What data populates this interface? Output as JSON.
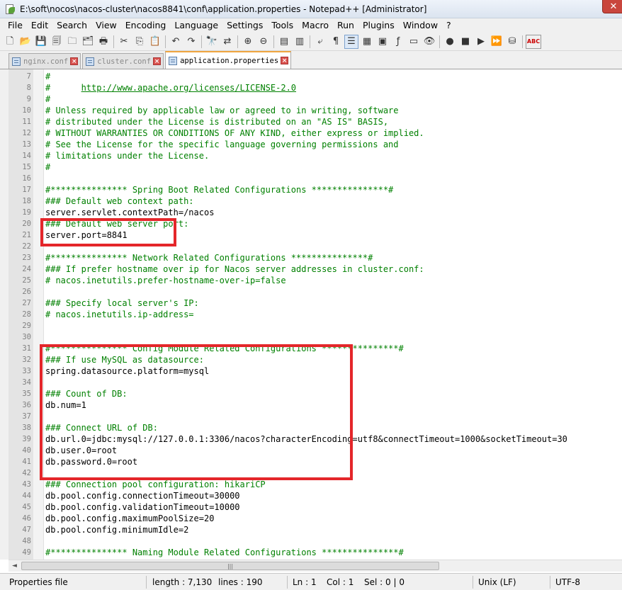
{
  "window": {
    "title": "E:\\soft\\nocos\\nacos-cluster\\nacos8841\\conf\\application.properties - Notepad++ [Administrator]",
    "close_glyph": "✕"
  },
  "menu": [
    "File",
    "Edit",
    "Search",
    "View",
    "Encoding",
    "Language",
    "Settings",
    "Tools",
    "Macro",
    "Run",
    "Plugins",
    "Window",
    "?"
  ],
  "toolbar": {
    "buttons": [
      {
        "icon": "new-file-icon",
        "glyph": "🗋"
      },
      {
        "icon": "open-file-icon",
        "glyph": "📂"
      },
      {
        "icon": "save-icon",
        "glyph": "💾"
      },
      {
        "icon": "save-all-icon",
        "glyph": "🗐"
      },
      {
        "icon": "close-icon",
        "glyph": "🗀"
      },
      {
        "icon": "close-all-icon",
        "glyph": "🗂"
      },
      {
        "icon": "print-icon",
        "glyph": "🖶"
      },
      {
        "sep": true
      },
      {
        "icon": "cut-icon",
        "glyph": "✂"
      },
      {
        "icon": "copy-icon",
        "glyph": "⎘"
      },
      {
        "icon": "paste-icon",
        "glyph": "📋"
      },
      {
        "sep": true
      },
      {
        "icon": "undo-icon",
        "glyph": "↶"
      },
      {
        "icon": "redo-icon",
        "glyph": "↷"
      },
      {
        "sep": true
      },
      {
        "icon": "find-icon",
        "glyph": "🔭"
      },
      {
        "icon": "replace-icon",
        "glyph": "⇄"
      },
      {
        "sep": true
      },
      {
        "icon": "zoom-in-icon",
        "glyph": "⊕"
      },
      {
        "icon": "zoom-out-icon",
        "glyph": "⊖"
      },
      {
        "sep": true
      },
      {
        "icon": "sync-vertical-icon",
        "glyph": "▤"
      },
      {
        "icon": "sync-horizontal-icon",
        "glyph": "▥"
      },
      {
        "sep": true
      },
      {
        "icon": "word-wrap-icon",
        "glyph": "⤶"
      },
      {
        "icon": "show-all-chars-icon",
        "glyph": "¶"
      },
      {
        "icon": "indent-guide-icon",
        "glyph": "☰",
        "active": true
      },
      {
        "icon": "user-lang-icon",
        "glyph": "▦"
      },
      {
        "icon": "doc-map-icon",
        "glyph": "▣"
      },
      {
        "icon": "function-list-icon",
        "glyph": "ƒ"
      },
      {
        "icon": "folder-workspace-icon",
        "glyph": "▭"
      },
      {
        "icon": "monitoring-icon",
        "glyph": "👁"
      },
      {
        "sep": true
      },
      {
        "icon": "record-macro-icon",
        "glyph": "●"
      },
      {
        "icon": "stop-macro-icon",
        "glyph": "■"
      },
      {
        "icon": "play-macro-icon",
        "glyph": "▶"
      },
      {
        "icon": "play-multiple-macro-icon",
        "glyph": "⏩"
      },
      {
        "icon": "save-macro-icon",
        "glyph": "⛁"
      },
      {
        "sep": true
      },
      {
        "icon": "spell-check-icon",
        "glyph": "ABC"
      }
    ]
  },
  "tabs": [
    {
      "label": "nginx.conf",
      "active": false
    },
    {
      "label": "cluster.conf",
      "active": false
    },
    {
      "label": "application.properties",
      "active": true
    }
  ],
  "editor": {
    "lines": [
      {
        "n": "7",
        "text": "#",
        "style": "comment"
      },
      {
        "n": "8",
        "text": "#      http://www.apache.org/licenses/LICENSE-2.0",
        "style": "url"
      },
      {
        "n": "9",
        "text": "#",
        "style": "comment"
      },
      {
        "n": "10",
        "text": "# Unless required by applicable law or agreed to in writing, software",
        "style": "comment"
      },
      {
        "n": "11",
        "text": "# distributed under the License is distributed on an \"AS IS\" BASIS,",
        "style": "comment"
      },
      {
        "n": "12",
        "text": "# WITHOUT WARRANTIES OR CONDITIONS OF ANY KIND, either express or implied.",
        "style": "comment"
      },
      {
        "n": "13",
        "text": "# See the License for the specific language governing permissions and",
        "style": "comment"
      },
      {
        "n": "14",
        "text": "# limitations under the License.",
        "style": "comment"
      },
      {
        "n": "15",
        "text": "#",
        "style": "comment"
      },
      {
        "n": "16",
        "text": "",
        "style": "plain"
      },
      {
        "n": "17",
        "text": "#*************** Spring Boot Related Configurations ***************#",
        "style": "comment"
      },
      {
        "n": "18",
        "text": "### Default web context path:",
        "style": "comment"
      },
      {
        "n": "19",
        "text": "server.servlet.contextPath=/nacos",
        "style": "plain"
      },
      {
        "n": "20",
        "text": "### Default web server port:",
        "style": "comment"
      },
      {
        "n": "21",
        "text": "server.port=8841",
        "style": "plain"
      },
      {
        "n": "22",
        "text": "",
        "style": "plain"
      },
      {
        "n": "23",
        "text": "#*************** Network Related Configurations ***************#",
        "style": "comment"
      },
      {
        "n": "24",
        "text": "### If prefer hostname over ip for Nacos server addresses in cluster.conf:",
        "style": "comment"
      },
      {
        "n": "25",
        "text": "# nacos.inetutils.prefer-hostname-over-ip=false",
        "style": "comment"
      },
      {
        "n": "26",
        "text": "",
        "style": "plain"
      },
      {
        "n": "27",
        "text": "### Specify local server's IP:",
        "style": "comment"
      },
      {
        "n": "28",
        "text": "# nacos.inetutils.ip-address=",
        "style": "comment"
      },
      {
        "n": "29",
        "text": "",
        "style": "plain"
      },
      {
        "n": "30",
        "text": "",
        "style": "plain"
      },
      {
        "n": "31",
        "text": "#*************** Config Module Related Configurations ***************#",
        "style": "comment"
      },
      {
        "n": "32",
        "text": "### If use MySQL as datasource:",
        "style": "comment"
      },
      {
        "n": "33",
        "text": "spring.datasource.platform=mysql",
        "style": "plain"
      },
      {
        "n": "34",
        "text": "",
        "style": "plain"
      },
      {
        "n": "35",
        "text": "### Count of DB:",
        "style": "comment"
      },
      {
        "n": "36",
        "text": "db.num=1",
        "style": "plain"
      },
      {
        "n": "37",
        "text": "",
        "style": "plain"
      },
      {
        "n": "38",
        "text": "### Connect URL of DB:",
        "style": "comment"
      },
      {
        "n": "39",
        "text": "db.url.0=jdbc:mysql://127.0.0.1:3306/nacos?characterEncoding=utf8&connectTimeout=1000&socketTimeout=30",
        "style": "plain"
      },
      {
        "n": "40",
        "text": "db.user.0=root",
        "style": "plain"
      },
      {
        "n": "41",
        "text": "db.password.0=root",
        "style": "plain"
      },
      {
        "n": "42",
        "text": "",
        "style": "plain"
      },
      {
        "n": "43",
        "text": "### Connection pool configuration: hikariCP",
        "style": "comment"
      },
      {
        "n": "44",
        "text": "db.pool.config.connectionTimeout=30000",
        "style": "plain"
      },
      {
        "n": "45",
        "text": "db.pool.config.validationTimeout=10000",
        "style": "plain"
      },
      {
        "n": "46",
        "text": "db.pool.config.maximumPoolSize=20",
        "style": "plain"
      },
      {
        "n": "47",
        "text": "db.pool.config.minimumIdle=2",
        "style": "plain"
      },
      {
        "n": "48",
        "text": "",
        "style": "plain"
      },
      {
        "n": "49",
        "text": "#*************** Naming Module Related Configurations ***************#",
        "style": "comment"
      }
    ]
  },
  "scrollbar": {
    "thumb_grip": "|||",
    "left_arrow": "◄"
  },
  "status": {
    "file_type": "Properties file",
    "length": "length : 7,130",
    "lines": "lines : 190",
    "ln": "Ln : 1",
    "col": "Col : 1",
    "sel": "Sel : 0 | 0",
    "eol": "Unix (LF)",
    "encoding": "UTF-8"
  },
  "colors": {
    "comment": "#008000",
    "highlight_box": "#e4262a",
    "gutter": "#e4e4e4"
  }
}
